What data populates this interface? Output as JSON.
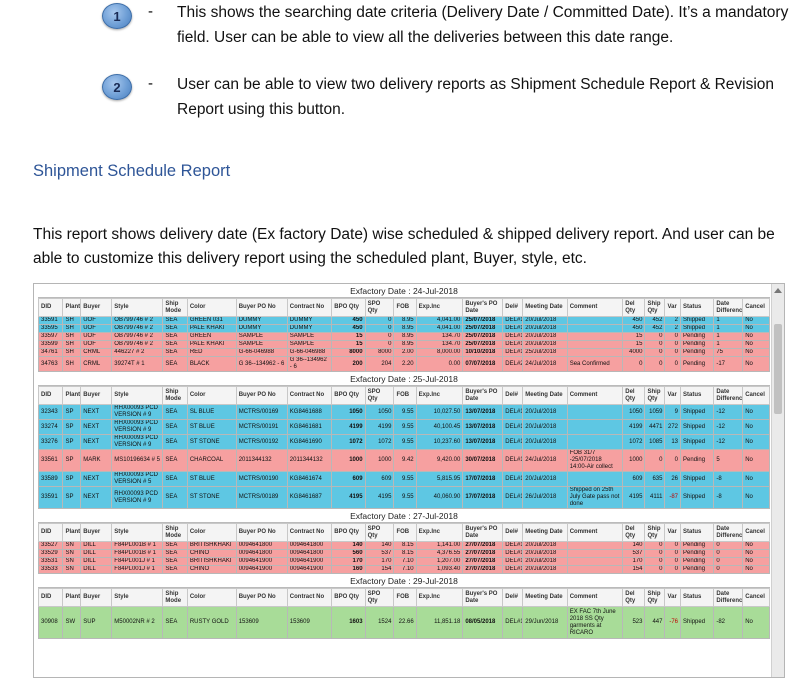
{
  "bullets": [
    {
      "num": "1",
      "dash": "-",
      "text": "This shows the searching date criteria (Delivery Date / Committed Date). It’s a mandatory field. User can be able to view all the deliveries between this date range."
    },
    {
      "num": "2",
      "dash": "-",
      "text": " User can be able to view two delivery reports as Shipment Schedule Report & Revision Report using this button."
    }
  ],
  "section_title": "Shipment Schedule Report",
  "paragraph": "This report shows delivery date (Ex factory Date) wise scheduled & shipped delivery report. And user can be able to customize this delivery report using the scheduled plant, Buyer, style, etc.",
  "report": {
    "columns": [
      "DID",
      "Plant",
      "Buyer",
      "Style",
      "Ship Mode",
      "Color",
      "Buyer PO No",
      "Contract No",
      "BPO Qty",
      "SPO Qty",
      "FOB",
      "Exp.Inc",
      "Buyer's PO Date",
      "Del#",
      "Meeting Date",
      "Comment",
      "Del Qty",
      "Ship Qty",
      "Var",
      "Status",
      "Date Difference",
      "Cancel"
    ],
    "groups": [
      {
        "title": "Exfactory Date : 24-Jul-2018",
        "rows": [
          {
            "color": "blue",
            "cells": [
              "33591",
              "SH",
              "UOF",
              "OB799746 # 2",
              "SEA",
              "GREEN 031",
              "DUMMY",
              "DUMMY",
              "450",
              "0",
              "8.95",
              "4,041.00",
              "25/07/2018",
              "DEL#1",
              "20/Jul/2018",
              "",
              "450",
              "452",
              "2",
              "Shipped",
              "1",
              "No"
            ]
          },
          {
            "color": "blue",
            "cells": [
              "33595",
              "SH",
              "UOF",
              "OB799746 # 2",
              "SEA",
              "PALE KHAKI",
              "DUMMY",
              "DUMMY",
              "450",
              "0",
              "8.95",
              "4,041.00",
              "25/07/2018",
              "DEL#1",
              "20/Jul/2018",
              "",
              "450",
              "452",
              "2",
              "Shipped",
              "1",
              "No"
            ]
          },
          {
            "color": "red",
            "cells": [
              "33597",
              "SH",
              "UOF",
              "OB799746 # 2",
              "SEA",
              "GREEN",
              "SAMPLE",
              "SAMPLE",
              "15",
              "0",
              "8.95",
              "134.70",
              "25/07/2018",
              "DEL#1",
              "20/Jul/2018",
              "",
              "15",
              "0",
              "0",
              "Pending",
              "1",
              "No"
            ]
          },
          {
            "color": "red",
            "cells": [
              "33599",
              "SH",
              "UOF",
              "OB799746 # 2",
              "SEA",
              "PALE KHAKI",
              "SAMPLE",
              "SAMPLE",
              "15",
              "0",
              "8.95",
              "134.70",
              "25/07/2018",
              "DEL#1",
              "20/Jul/2018",
              "",
              "15",
              "0",
              "0",
              "Pending",
              "1",
              "No"
            ]
          },
          {
            "color": "red",
            "cells": [
              "34761",
              "SH",
              "CRML",
              "446227 # 2",
              "SEA",
              "RED",
              "G-66-046988",
              "G-66-046988",
              "8000",
              "8000",
              "2.00",
              "8,000.00",
              "10/10/2018",
              "DEL#1",
              "25/Jul/2018",
              "",
              "4000",
              "0",
              "0",
              "Pending",
              "75",
              "No"
            ]
          },
          {
            "color": "red",
            "tall": true,
            "cells": [
              "34763",
              "SH",
              "CRML",
              "39274T # 1",
              "SEA",
              "BLACK",
              "G 36--134962 - 6",
              "G 36--134962 - 6",
              "200",
              "204",
              "2.20",
              "0.00",
              "07/07/2018",
              "DEL#2",
              "24/Jul/2018",
              "Sea Confirmed",
              "0",
              "0",
              "0",
              "Pending",
              "-17",
              "No"
            ]
          }
        ]
      },
      {
        "title": "Exfactory Date : 25-Jul-2018",
        "rows": [
          {
            "color": "blue",
            "tall": true,
            "cells": [
              "32343",
              "SP",
              "NEXT",
              "RHX00093 PCD VERSION # 9",
              "SEA",
              "SL BLUE",
              "MCTRS/00169",
              "KG8461688",
              "1050",
              "1050",
              "9.55",
              "10,027.50",
              "13/07/2018",
              "DEL#1",
              "20/Jul/2018",
              "",
              "1050",
              "1059",
              "9",
              "Shipped",
              "-12",
              "No"
            ]
          },
          {
            "color": "blue",
            "tall": true,
            "cells": [
              "33274",
              "SP",
              "NEXT",
              "RHX00093 PCD VERSION # 9",
              "SEA",
              "ST BLUE",
              "MCTRS/00191",
              "KG8461681",
              "4199",
              "4199",
              "9.55",
              "40,100.45",
              "13/07/2018",
              "DEL#1",
              "20/Jul/2018",
              "",
              "4199",
              "4471",
              "272",
              "Shipped",
              "-12",
              "No"
            ]
          },
          {
            "color": "blue",
            "tall": true,
            "cells": [
              "33276",
              "SP",
              "NEXT",
              "RHX00093 PCD VERSION # 9",
              "SEA",
              "ST STONE",
              "MCTRS/00192",
              "KG8461690",
              "1072",
              "1072",
              "9.55",
              "10,237.60",
              "13/07/2018",
              "DEL#1",
              "20/Jul/2018",
              "",
              "1072",
              "1085",
              "13",
              "Shipped",
              "-12",
              "No"
            ]
          },
          {
            "color": "red",
            "tall2": true,
            "cells": [
              "33561",
              "SP",
              "MARK",
              "MS10196634 # 5",
              "SEA",
              "CHARCOAL",
              "2011344132",
              "2011344132",
              "1000",
              "1000",
              "9.42",
              "9,420.00",
              "30/07/2018",
              "DEL#1",
              "24/Jul/2018",
              "FOB 31/7 -25/07/2018 14:00-Air collect",
              "1000",
              "0",
              "0",
              "Pending",
              "5",
              "No"
            ]
          },
          {
            "color": "blue",
            "tall": true,
            "cells": [
              "33589",
              "SP",
              "NEXT",
              "RHX00093 PCD VERSION # 5",
              "SEA",
              "ST BLUE",
              "MCTRS/00190",
              "KG8461674",
              "609",
              "609",
              "9.55",
              "5,815.95",
              "17/07/2018",
              "DEL#1",
              "20/Jul/2018",
              "",
              "609",
              "635",
              "26",
              "Shipped",
              "-8",
              "No"
            ]
          },
          {
            "color": "blue",
            "tall2": true,
            "cells": [
              "33591",
              "SP",
              "NEXT",
              "RHX00093 PCD VERSION # 9",
              "SEA",
              "ST STONE",
              "MCTRS/00189",
              "KG8461687",
              "4195",
              "4195",
              "9.55",
              "40,060.90",
              "17/07/2018",
              "DEL#1",
              "26/Jul/2018",
              "Shipped on 25th July Gate pass not done",
              "4195",
              "4111",
              "-87",
              "Shipped",
              "-8",
              "No"
            ]
          }
        ]
      },
      {
        "title": "Exfactory Date : 27-Jul-2018",
        "rows": [
          {
            "color": "red",
            "cells": [
              "33527",
              "SN",
              "DILL",
              "F84PL001B # 1",
              "SEA",
              "BRITISHKHAKI",
              "0094641800",
              "0094641800",
              "140",
              "140",
              "8.15",
              "1,141.00",
              "27/07/2018",
              "DEL#1",
              "20/Jul/2018",
              "",
              "140",
              "0",
              "0",
              "Pending",
              "0",
              "No"
            ]
          },
          {
            "color": "red",
            "cells": [
              "33529",
              "SN",
              "DILL",
              "F84PL001B # 1",
              "SEA",
              "CHINO",
              "0094641800",
              "0094641800",
              "560",
              "537",
              "8.15",
              "4,376.55",
              "27/07/2018",
              "DEL#1",
              "20/Jul/2018",
              "",
              "537",
              "0",
              "0",
              "Pending",
              "0",
              "No"
            ]
          },
          {
            "color": "red",
            "cells": [
              "33531",
              "SN",
              "DILL",
              "F84PL001J # 1",
              "SEA",
              "BRITISHKHAKI",
              "0094641900",
              "0094641900",
              "170",
              "170",
              "7.10",
              "1,207.00",
              "27/07/2018",
              "DEL#1",
              "20/Jul/2018",
              "",
              "170",
              "0",
              "0",
              "Pending",
              "0",
              "No"
            ]
          },
          {
            "color": "red",
            "cells": [
              "33533",
              "SN",
              "DILL",
              "F84PL001J # 1",
              "SEA",
              "CHINO",
              "0094641900",
              "0094641900",
              "160",
              "154",
              "7.10",
              "1,093.40",
              "27/07/2018",
              "DEL#1",
              "20/Jul/2018",
              "",
              "154",
              "0",
              "0",
              "Pending",
              "0",
              "No"
            ]
          }
        ]
      },
      {
        "title": "Exfactory Date : 29-Jul-2018",
        "rows": [
          {
            "color": "green",
            "tall3": true,
            "cells": [
              "30908",
              "SW",
              "SUP",
              "M50002NR # 2",
              "SEA",
              "RUSTY GOLD",
              "153609",
              "153609",
              "1603",
              "1524",
              "22.66",
              "11,851.18",
              "08/05/2018",
              "DEL#1",
              "29/Jun/2018",
              "EX FAC 7th June 2018 SS Qty garments at RICARO",
              "523",
              "447",
              "-76",
              "Shipped",
              "-82",
              "No"
            ]
          }
        ]
      }
    ]
  }
}
